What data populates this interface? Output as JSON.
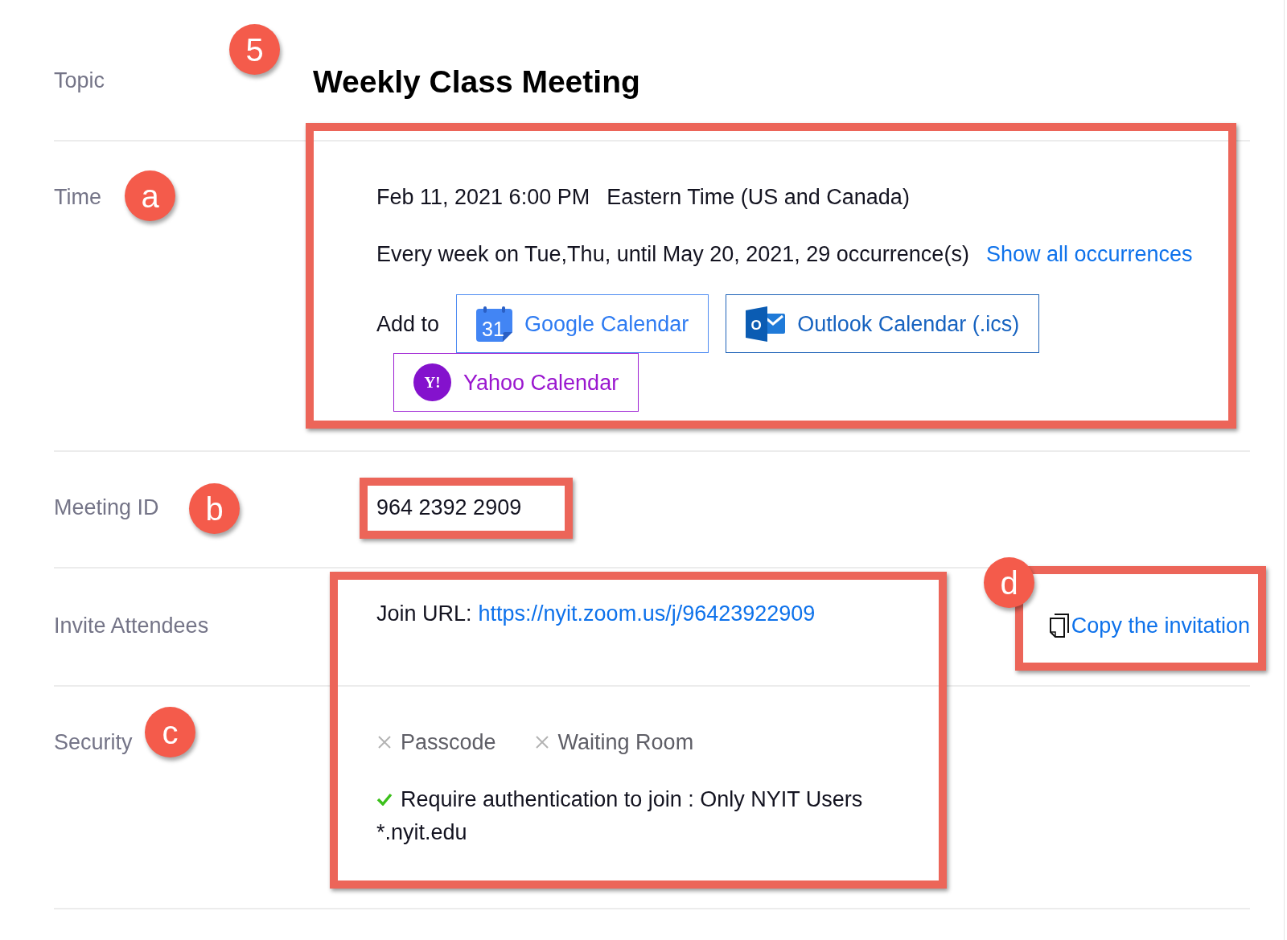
{
  "topic": {
    "label": "Topic",
    "title": "Weekly Class Meeting"
  },
  "time": {
    "label": "Time",
    "start": "Feb 11, 2021 6:00 PM",
    "timezone": "Eastern Time (US and Canada)",
    "recurrence": "Every week on Tue,Thu, until May 20, 2021, 29 occurrence(s)",
    "show_all_link": "Show all occurrences",
    "add_to_label": "Add to",
    "calendars": [
      {
        "kind": "google",
        "label": "Google Calendar",
        "icon_text": "31"
      },
      {
        "kind": "outlook",
        "label": "Outlook Calendar (.ics)",
        "icon_text": "O"
      },
      {
        "kind": "yahoo",
        "label": "Yahoo Calendar",
        "icon_text": "Y!"
      }
    ]
  },
  "meeting_id": {
    "label": "Meeting ID",
    "value": "964 2392 2909"
  },
  "invite_attendees": {
    "label": "Invite Attendees",
    "join_url_label": "Join URL:",
    "join_url": "https://nyit.zoom.us/j/96423922909",
    "copy_link": "Copy the invitation"
  },
  "security": {
    "label": "Security",
    "options": [
      {
        "label": "Passcode",
        "enabled": false
      },
      {
        "label": "Waiting Room",
        "enabled": false
      },
      {
        "label": "Require authentication to join : Only NYIT Users",
        "enabled": true,
        "detail": "*.nyit.edu"
      }
    ]
  },
  "annotations": [
    {
      "label": "5",
      "framed": false
    },
    {
      "label": "a",
      "framed": true
    },
    {
      "label": "b",
      "framed": true
    },
    {
      "label": "c",
      "framed": true
    },
    {
      "label": "d",
      "framed": true
    }
  ]
}
